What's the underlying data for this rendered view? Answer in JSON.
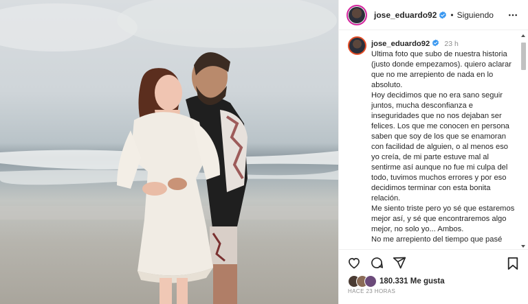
{
  "post": {
    "username": "jose_eduardo92",
    "follow_status": "Siguiendo",
    "separator": "•"
  },
  "caption": {
    "username": "jose_eduardo92",
    "time": "23 h",
    "paragraphs": [
      "Ultima foto que subo de nuestra historia (justo donde empezamos). quiero aclarar que no me arrepiento de nada en lo absoluto.",
      "Hoy decidimos que no era sano seguir juntos, mucha desconfianza e inseguridades que no nos dejaban ser felices. Los que me conocen en persona saben que soy de los que se enamoran con facilidad de alguien, o al menos eso yo creía, de mi parte estuve mal al sentirme así aunque no fue mi culpa del todo, tuvimos muchos errores y por eso decidimos terminar con esta bonita relación.",
      "Me siento triste pero yo sé que estaremos mejor así, y sé que encontraremos algo mejor, no solo yo... Ambos.",
      "No me arrepiento del tiempo que pasé"
    ]
  },
  "likes": {
    "count": "180.331",
    "label": "Me gusta"
  },
  "timestamp": "HACE 23 HORAS",
  "icons": {
    "verified": "verified-badge-icon",
    "more": "more-options-icon",
    "like": "heart-icon",
    "comment": "comment-icon",
    "share": "share-icon",
    "save": "bookmark-icon"
  },
  "colors": {
    "verified": "#3897f0",
    "story_ring": "#d6249f",
    "muted_text": "#8e8e8e"
  }
}
